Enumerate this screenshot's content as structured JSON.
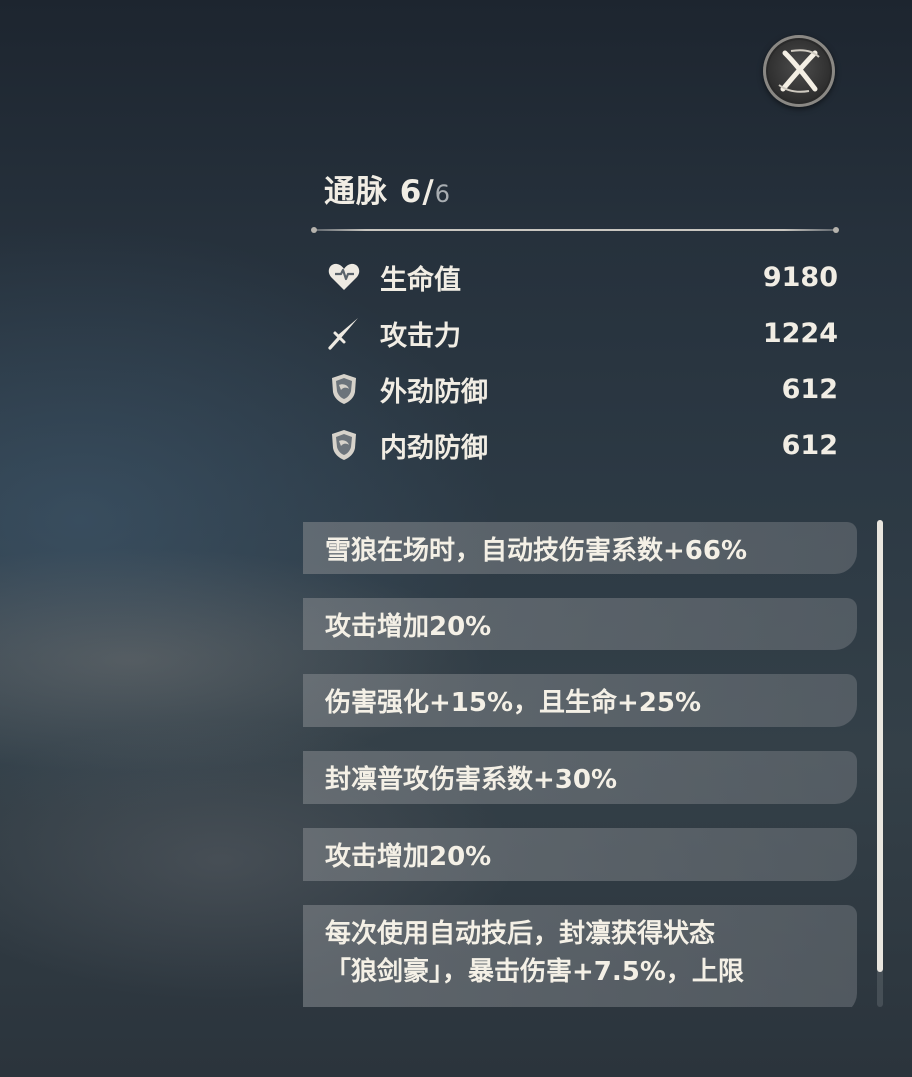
{
  "header": {
    "title_label": "通脉",
    "level_current": "6/",
    "level_max": "6"
  },
  "close_button": {
    "icon": "close-x-icon"
  },
  "stats": [
    {
      "icon": "heart-icon",
      "label": "生命值",
      "value": "9180"
    },
    {
      "icon": "sword-icon",
      "label": "攻击力",
      "value": "1224"
    },
    {
      "icon": "shield-icon",
      "label": "外劲防御",
      "value": "612"
    },
    {
      "icon": "shield-icon",
      "label": "内劲防御",
      "value": "612"
    }
  ],
  "effects": [
    {
      "text": "雪狼在场时，自动技伤害系数+66%"
    },
    {
      "text": "攻击增加20%"
    },
    {
      "text": "伤害强化+15%，且生命+25%"
    },
    {
      "text": "封凛普攻伤害系数+30%"
    },
    {
      "text": "攻击增加20%"
    },
    {
      "line1": "每次使用自动技后，封凛获得状态",
      "line2": "「狼剑豪」，暴击伤害+7.5%，上限"
    }
  ],
  "colors": {
    "text": "#f1ede4",
    "panel": "#7d8287",
    "accent": "#c9c6c0"
  }
}
